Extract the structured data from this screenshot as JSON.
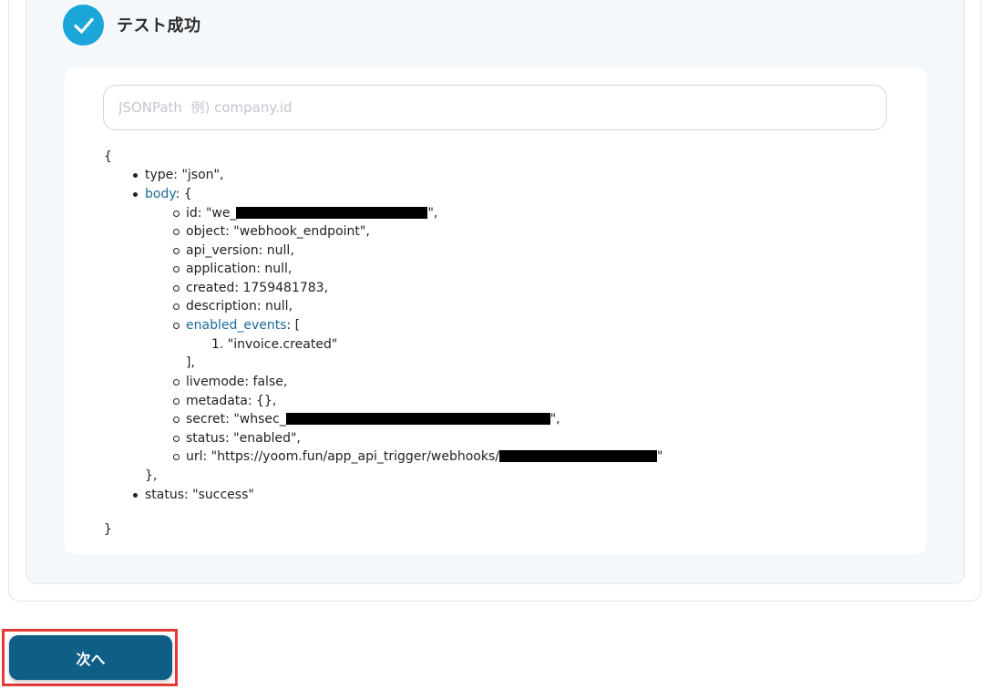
{
  "status": {
    "title": "テスト成功",
    "icon": "check-circle-icon",
    "accent_color": "#1aa6d9"
  },
  "search": {
    "placeholder": "JSONPath  例) company.id",
    "value": ""
  },
  "json_output": {
    "open_brace": "{",
    "close_brace": "}",
    "type_line": "type: \"json\",",
    "body_key": "body",
    "body_open": ": {",
    "body_fields": {
      "id_prefix": "id: \"we_",
      "id_suffix": "\",",
      "object": "object: \"webhook_endpoint\",",
      "api_version": "api_version: null,",
      "application": "application: null,",
      "created": "created: 1759481783,",
      "description": "description: null,",
      "enabled_events_key": "enabled_events",
      "enabled_events_open": ": [",
      "enabled_events_item": "1. \"invoice.created\"",
      "enabled_events_close": "],",
      "livemode": "livemode: false,",
      "metadata": "metadata: {},",
      "secret_prefix": "secret: \"whsec_",
      "secret_suffix": "\",",
      "status": "status: \"enabled\",",
      "url_prefix": "url: \"https://yoom.fun/app_api_trigger/webhooks/",
      "url_suffix": "\""
    },
    "body_close": "},",
    "status_line": "status: \"success\""
  },
  "footer": {
    "next_label": "次へ",
    "next_color": "#0f5e85",
    "highlight_color": "#e53935"
  }
}
